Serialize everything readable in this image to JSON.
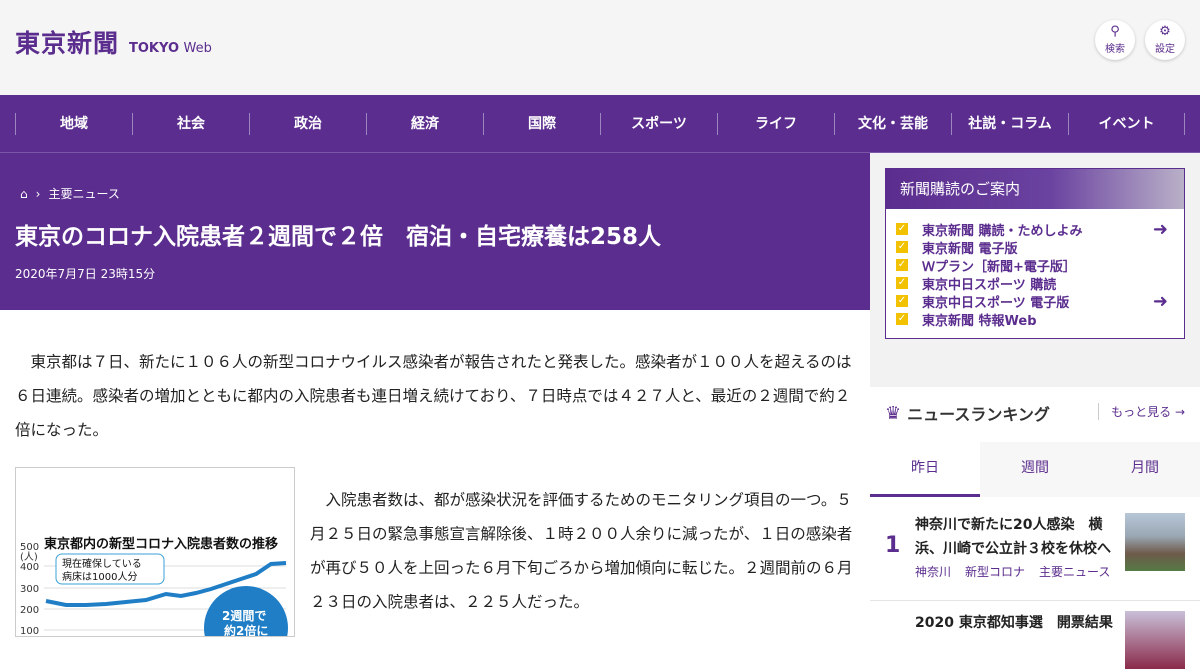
{
  "header": {
    "logo_jp": "東京新聞",
    "logo_en_bold": "TOKYO",
    "logo_en_light": "Web",
    "search_label": "検索",
    "settings_label": "設定"
  },
  "nav": [
    "地域",
    "社会",
    "政治",
    "経済",
    "国際",
    "スポーツ",
    "ライフ",
    "文化・芸能",
    "社説・コラム",
    "イベント"
  ],
  "breadcrumb": {
    "section": "主要ニュース"
  },
  "article": {
    "title": "東京のコロナ入院患者２週間で２倍　宿泊・自宅療養は258人",
    "date": "2020年7月7日 23時15分",
    "para1": "　東京都は７日、新たに１０６人の新型コロナウイルス感染者が報告されたと発表した。感染者が１００人を超えるのは６日連続。感染者の増加とともに都内の入院患者も連日増え続けており、７日時点では４２７人と、最近の２週間で約２倍になった。",
    "para2": "　入院患者数は、都が感染状況を評価するためのモニタリング項目の一つ。５月２５日の緊急事態宣言解除後、１時２００人余りに減ったが、１日の感染者が再び５０人を上回った６月下旬ごろから増加傾向に転じた。２週間前の６月２３日の入院患者は、２２５人だった。"
  },
  "figure": {
    "title": "東京都内の新型コロナ入院患者数の推移",
    "unit": "(人)",
    "yticks": [
      "500",
      "400",
      "300",
      "200",
      "100"
    ],
    "note": "現在確保している病床は1000人分",
    "callout": "2週間で約2倍に",
    "accent": "#1f7ec6"
  },
  "subscription": {
    "title": "新聞購読のご案内",
    "items": [
      {
        "label": "東京新聞 購読・ためしよみ",
        "login": true
      },
      {
        "label": "東京新聞 電子版",
        "login": false
      },
      {
        "label": "Ｗプラン［新聞+電子版］",
        "login": false
      },
      {
        "label": "東京中日スポーツ 購読",
        "login": false
      },
      {
        "label": "東京中日スポーツ 電子版",
        "login": true
      },
      {
        "label": "東京新聞 特報Web",
        "login": false
      }
    ]
  },
  "ranking": {
    "title": "ニュースランキング",
    "more": "もっと見る",
    "tabs": [
      "昨日",
      "週間",
      "月間"
    ],
    "items": [
      {
        "rank": "1",
        "title": "神奈川で新たに20人感染　横浜、川崎で公立計３校を休校へ",
        "tags": [
          "神奈川",
          "新型コロナ",
          "主要ニュース"
        ]
      },
      {
        "rank": "",
        "title": "2020 東京都知事選　開票結果",
        "tags": []
      }
    ]
  },
  "colors": {
    "brand": "#5b2d8e",
    "check": "#f2c200"
  }
}
